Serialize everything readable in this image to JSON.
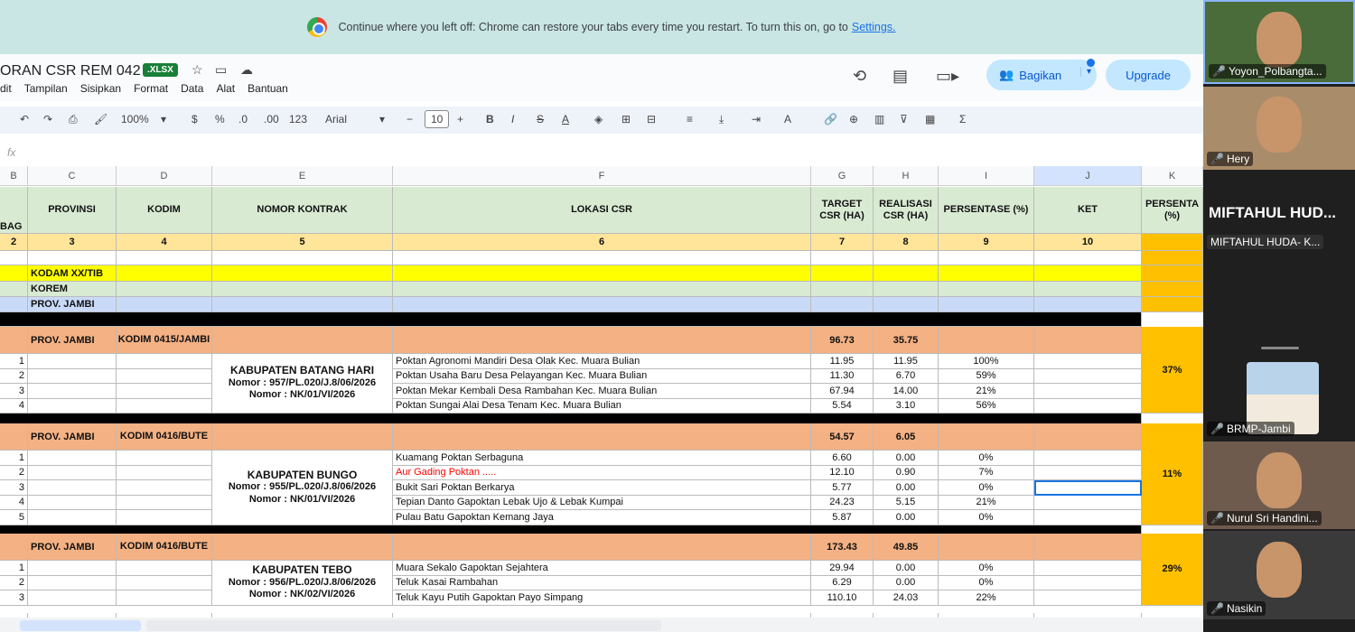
{
  "browser": {
    "banner_text": "Continue where you left off: Chrome can restore your tabs every time you restart. To turn this on, go to",
    "banner_link": "Settings."
  },
  "doc": {
    "title": "ORAN  CSR REM 042",
    "badge": ".XLSX",
    "menu": [
      "dit",
      "Tampilan",
      "Sisipkan",
      "Format",
      "Data",
      "Alat",
      "Bantuan"
    ],
    "share_label": "Bagikan",
    "upgrade_label": "Upgrade"
  },
  "toolbar": {
    "zoom": "100%",
    "currency": "$",
    "percent": "%",
    "dec_less": ".0",
    "dec_more": ".00",
    "number_fmt": "123",
    "font": "Arial",
    "font_size": "10",
    "bold": "B",
    "italic": "I",
    "strike": "S",
    "text_color": "A",
    "sum": "Σ"
  },
  "formula_bar": {
    "fx": "fx"
  },
  "columns": [
    "B",
    "C",
    "D",
    "E",
    "F",
    "G",
    "H",
    "I",
    "J",
    "K"
  ],
  "header": {
    "b": "BAG",
    "provinsi": "PROVINSI",
    "kodim": "KODIM",
    "kontrak": "NOMOR KONTRAK",
    "lokasi": "LOKASI CSR",
    "target": "TARGET CSR (HA)",
    "realisasi": "REALISASI CSR (HA)",
    "persentase": "PERSENTASE (%)",
    "ket": "KET",
    "persenta": "PERSENTA (%)"
  },
  "numbers_row": [
    "2",
    "3",
    "4",
    "5",
    "6",
    "7",
    "8",
    "9",
    "10"
  ],
  "labels": {
    "kodam": "KODAM XX/TIB",
    "korem": "KOREM",
    "prov": "PROV. JAMBI"
  },
  "groups": [
    {
      "prov": "PROV. JAMBI",
      "kodim": "KODIM 0415/JAMBI",
      "target": "96.73",
      "realisasi": "35.75",
      "persen": "37%",
      "kontrak": [
        "KABUPATEN BATANG HARI",
        "Nomor : 957/PL.020/J.8/06/2026",
        "Nomor : NK/01/VI/2026"
      ],
      "rows": [
        {
          "no": "1",
          "lokasi": "Poktan Agronomi Mandiri Desa Olak Kec. Muara Bulian",
          "target": "11.95",
          "realisasi": "11.95",
          "persen": "100%"
        },
        {
          "no": "2",
          "lokasi": "Poktan Usaha Baru Desa Pelayangan Kec. Muara Bulian",
          "target": "11.30",
          "realisasi": "6.70",
          "persen": "59%"
        },
        {
          "no": "3",
          "lokasi": "Poktan Mekar Kembali Desa Rambahan Kec. Muara Bulian",
          "target": "67.94",
          "realisasi": "14.00",
          "persen": "21%"
        },
        {
          "no": "4",
          "lokasi": "Poktan Sungai Alai Desa Tenam Kec. Muara Bulian",
          "target": "5.54",
          "realisasi": "3.10",
          "persen": "56%"
        }
      ]
    },
    {
      "prov": "PROV. JAMBI",
      "kodim": "KODIM 0416/BUTE",
      "target": "54.57",
      "realisasi": "6.05",
      "persen": "11%",
      "kontrak": [
        "KABUPATEN BUNGO",
        "Nomor : 955/PL.020/J.8/06/2026",
        "Nomor : NK/01/VI/2026"
      ],
      "rows": [
        {
          "no": "1",
          "lokasi": "Kuamang Poktan Serbaguna",
          "target": "6.60",
          "realisasi": "0.00",
          "persen": "0%"
        },
        {
          "no": "2",
          "lokasi": "Aur Gading Poktan .....",
          "target": "12.10",
          "realisasi": "0.90",
          "persen": "7%",
          "red": true
        },
        {
          "no": "3",
          "lokasi": "Bukit Sari Poktan Berkarya",
          "target": "5.77",
          "realisasi": "0.00",
          "persen": "0%"
        },
        {
          "no": "4",
          "lokasi": "Tepian Danto Gapoktan Lebak Ujo & Lebak Kumpai",
          "target": "24.23",
          "realisasi": "5.15",
          "persen": "21%"
        },
        {
          "no": "5",
          "lokasi": "Pulau Batu Gapoktan Kemang Jaya",
          "target": "5.87",
          "realisasi": "0.00",
          "persen": "0%"
        }
      ]
    },
    {
      "prov": "PROV. JAMBI",
      "kodim": "KODIM 0416/BUTE",
      "target": "173.43",
      "realisasi": "49.85",
      "persen": "29%",
      "kontrak": [
        "KABUPATEN TEBO",
        "Nomor : 956/PL.020/J.8/06/2026",
        "Nomor : NK/02/VI/2026"
      ],
      "rows": [
        {
          "no": "1",
          "lokasi": "Muara Sekalo Gapoktan Sejahtera",
          "target": "29.94",
          "realisasi": "0.00",
          "persen": "0%"
        },
        {
          "no": "2",
          "lokasi": "Teluk Kasai Rambahan",
          "target": "6.29",
          "realisasi": "0.00",
          "persen": "0%"
        },
        {
          "no": "3",
          "lokasi": "Teluk Kayu Putih Gapoktan Payo Simpang",
          "target": "110.10",
          "realisasi": "24.03",
          "persen": "22%"
        }
      ]
    }
  ],
  "participants": [
    {
      "name": "Yoyon_Polbangta...",
      "kind": "video",
      "bg": "#4a6b3a"
    },
    {
      "name": "Hery",
      "kind": "video",
      "bg": "#a98c6a"
    },
    {
      "name": "MIFTAHUL HUD...",
      "sub": "MIFTAHUL HUDA- K...",
      "kind": "text"
    },
    {
      "name": "BRMP-Jambi",
      "kind": "image"
    },
    {
      "name": "Nurul Sri Handini...",
      "kind": "video",
      "bg": "#6e5b4e"
    },
    {
      "name": "Nasikin",
      "kind": "video",
      "bg": "#3a3a3a"
    }
  ],
  "colors": {
    "header_green": "#d9ead3",
    "salmon": "#f4b183",
    "orange": "#ffc000",
    "yellow": "#ffff00",
    "red_text": "#ff0000"
  }
}
